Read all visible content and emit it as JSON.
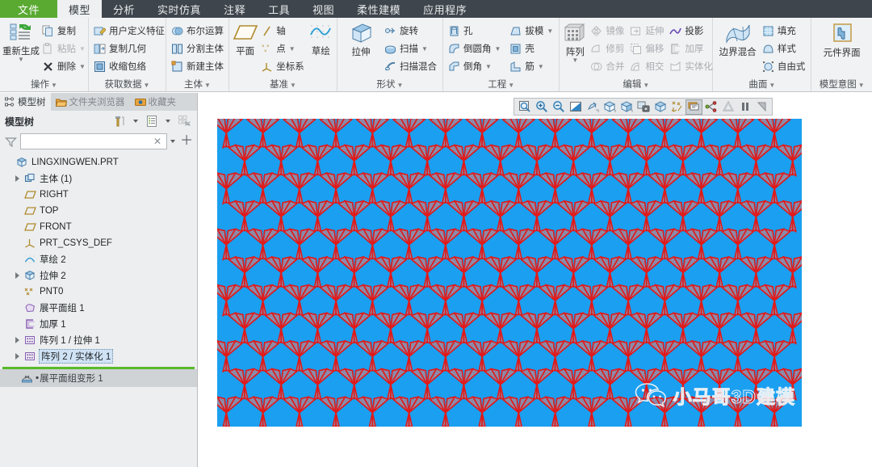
{
  "app": {
    "menu_tabs": [
      {
        "label": "文件",
        "state": "file"
      },
      {
        "label": "模型",
        "state": "active"
      },
      {
        "label": "分析",
        "state": "normal"
      },
      {
        "label": "实时仿真",
        "state": "normal"
      },
      {
        "label": "注释",
        "state": "normal"
      },
      {
        "label": "工具",
        "state": "normal"
      },
      {
        "label": "视图",
        "state": "normal"
      },
      {
        "label": "柔性建模",
        "state": "normal"
      },
      {
        "label": "应用程序",
        "state": "normal"
      }
    ]
  },
  "ribbon": {
    "groups": [
      {
        "title": "操作",
        "has_dropdown": true,
        "big": {
          "label": "重新生成",
          "icon": "regenerate-icon",
          "has_caret": true
        },
        "items": [
          {
            "label": "复制",
            "icon": "copy-icon",
            "caret": false,
            "disabled": false
          },
          {
            "label": "粘贴",
            "icon": "paste-icon",
            "caret": true,
            "disabled": true
          },
          {
            "label": "删除",
            "icon": "delete-icon",
            "caret": true,
            "disabled": false
          }
        ]
      },
      {
        "title": "获取数据",
        "has_dropdown": true,
        "items": [
          {
            "label": "用户定义特征",
            "icon": "udf-icon",
            "caret": false,
            "disabled": false
          },
          {
            "label": "复制几何",
            "icon": "copy-geometry-icon",
            "caret": false,
            "disabled": false
          },
          {
            "label": "收缩包络",
            "icon": "shrinkwrap-icon",
            "caret": false,
            "disabled": false
          }
        ]
      },
      {
        "title": "主体",
        "has_dropdown": true,
        "items": [
          {
            "label": "布尔运算",
            "icon": "boolean-icon",
            "caret": false,
            "disabled": false
          },
          {
            "label": "分割主体",
            "icon": "split-body-icon",
            "caret": false,
            "disabled": false
          },
          {
            "label": "新建主体",
            "icon": "new-body-icon",
            "caret": false,
            "disabled": false
          }
        ]
      },
      {
        "title": "基准",
        "has_dropdown": true,
        "big": {
          "label": "平面",
          "icon": "datum-plane-icon",
          "has_caret": false
        },
        "items": [
          {
            "label": "轴",
            "icon": "datum-axis-icon",
            "caret": false,
            "disabled": false
          },
          {
            "label": "点",
            "icon": "datum-point-icon",
            "caret": true,
            "disabled": false
          },
          {
            "label": "坐标系",
            "icon": "datum-csys-icon",
            "caret": false,
            "disabled": false
          }
        ],
        "big2": {
          "label": "草绘",
          "icon": "sketch-icon",
          "has_caret": false
        }
      },
      {
        "title": "形状",
        "has_dropdown": true,
        "big": {
          "label": "拉伸",
          "icon": "extrude-icon",
          "has_caret": false
        },
        "items": [
          {
            "label": "旋转",
            "icon": "revolve-icon",
            "caret": false,
            "disabled": false
          },
          {
            "label": "扫描",
            "icon": "sweep-icon",
            "caret": true,
            "disabled": false
          },
          {
            "label": "扫描混合",
            "icon": "swept-blend-icon",
            "caret": false,
            "disabled": false
          }
        ]
      },
      {
        "title": "工程",
        "has_dropdown": true,
        "items": [
          {
            "label": "孔",
            "icon": "hole-icon",
            "caret": false,
            "disabled": false
          },
          {
            "label": "倒圆角",
            "icon": "round-icon",
            "caret": true,
            "disabled": false
          },
          {
            "label": "倒角",
            "icon": "chamfer-icon",
            "caret": true,
            "disabled": false
          }
        ],
        "items2": [
          {
            "label": "拔模",
            "icon": "draft-icon",
            "caret": true,
            "disabled": false
          },
          {
            "label": "壳",
            "icon": "shell-icon",
            "caret": false,
            "disabled": false
          },
          {
            "label": "筋",
            "icon": "rib-icon",
            "caret": true,
            "disabled": false
          }
        ]
      },
      {
        "title": "编辑",
        "has_dropdown": true,
        "big": {
          "label": "阵列",
          "icon": "pattern-icon",
          "has_caret": true
        },
        "items": [
          {
            "label": "镜像",
            "icon": "mirror-icon",
            "caret": false,
            "disabled": true
          },
          {
            "label": "修剪",
            "icon": "trim-icon",
            "caret": false,
            "disabled": true
          },
          {
            "label": "合并",
            "icon": "merge-icon",
            "caret": false,
            "disabled": true
          }
        ],
        "items2": [
          {
            "label": "延伸",
            "icon": "extend-icon",
            "caret": false,
            "disabled": true
          },
          {
            "label": "偏移",
            "icon": "offset-icon",
            "caret": false,
            "disabled": true
          },
          {
            "label": "相交",
            "icon": "intersect-icon",
            "caret": false,
            "disabled": true
          }
        ],
        "items3": [
          {
            "label": "投影",
            "icon": "project-icon",
            "caret": false,
            "disabled": false
          },
          {
            "label": "加厚",
            "icon": "thicken-icon",
            "caret": false,
            "disabled": true
          },
          {
            "label": "实体化",
            "icon": "solidify-icon",
            "caret": false,
            "disabled": true
          }
        ]
      },
      {
        "title": "曲面",
        "has_dropdown": true,
        "big": {
          "label": "边界混合",
          "icon": "boundary-blend-icon",
          "has_caret": false
        },
        "items": [
          {
            "label": "填充",
            "icon": "fill-icon",
            "caret": false,
            "disabled": false
          },
          {
            "label": "样式",
            "icon": "style-icon",
            "caret": false,
            "disabled": false
          },
          {
            "label": "自由式",
            "icon": "freestyle-icon",
            "caret": false,
            "disabled": false
          }
        ]
      },
      {
        "title": "模型意图",
        "has_dropdown": true,
        "big": {
          "label": "元件界面",
          "icon": "component-interface-icon",
          "has_caret": false
        },
        "items": []
      }
    ]
  },
  "left_panel": {
    "tabs": [
      {
        "label": "模型树",
        "icon": "model-tree-icon",
        "active": true
      },
      {
        "label": "文件夹浏览器",
        "icon": "folder-browser-icon",
        "active": false
      },
      {
        "label": "收藏夹",
        "icon": "favorites-icon",
        "active": false
      }
    ],
    "header": {
      "title": "模型树",
      "settings_icon": "tree-filters-icon",
      "display_icon": "tree-display-icon",
      "columns_icon": "tree-columns-icon"
    },
    "filter": {
      "icon": "filter-icon",
      "value": "",
      "placeholder": "",
      "clear_icon": "clear-icon",
      "dropdown_icon": "chevron-down-icon",
      "add_icon": "add-icon"
    },
    "tree": [
      {
        "label": "LINGXINGWEN.PRT",
        "icon": "part-icon",
        "indent": 0,
        "expandable": false,
        "selected": false
      },
      {
        "label": "主体 (1)",
        "icon": "bodies-icon",
        "indent": 1,
        "expandable": true,
        "selected": false
      },
      {
        "label": "RIGHT",
        "icon": "datum-plane-icon",
        "indent": 1,
        "expandable": false,
        "selected": false
      },
      {
        "label": "TOP",
        "icon": "datum-plane-icon",
        "indent": 1,
        "expandable": false,
        "selected": false
      },
      {
        "label": "FRONT",
        "icon": "datum-plane-icon",
        "indent": 1,
        "expandable": false,
        "selected": false
      },
      {
        "label": "PRT_CSYS_DEF",
        "icon": "datum-csys-icon",
        "indent": 1,
        "expandable": false,
        "selected": false
      },
      {
        "label": "草绘 2",
        "icon": "sketch-icon",
        "indent": 1,
        "expandable": false,
        "selected": false
      },
      {
        "label": "拉伸 2",
        "icon": "extrude-icon",
        "indent": 1,
        "expandable": true,
        "selected": false
      },
      {
        "label": "PNT0",
        "icon": "datum-point-icon",
        "indent": 1,
        "expandable": false,
        "selected": false
      },
      {
        "label": "展平面组 1",
        "icon": "flatten-quilt-icon",
        "indent": 1,
        "expandable": false,
        "selected": false
      },
      {
        "label": "加厚 1",
        "icon": "thicken-icon",
        "indent": 1,
        "expandable": false,
        "selected": false
      },
      {
        "label": "阵列 1 / 拉伸 1",
        "icon": "pattern-icon",
        "indent": 1,
        "expandable": true,
        "selected": false
      },
      {
        "label": "阵列 2 / 实体化 1",
        "icon": "pattern-icon",
        "indent": 1,
        "expandable": true,
        "selected": true
      }
    ],
    "inserted_row": {
      "label": "展平面组变形 1",
      "icon": "flatten-deform-icon",
      "prefix": "▪"
    }
  },
  "graphics_toolbar": {
    "buttons": [
      {
        "name": "refit-icon",
        "pressed": false
      },
      {
        "name": "zoom-in-icon",
        "pressed": false
      },
      {
        "name": "zoom-out-icon",
        "pressed": false
      },
      {
        "name": "repaint-icon",
        "pressed": false
      },
      {
        "name": "spin-center-icon",
        "pressed": false
      },
      {
        "name": "saved-orientations-icon",
        "pressed": false
      },
      {
        "name": "view-manager-icon",
        "pressed": false
      },
      {
        "name": "scene-capture-icon",
        "pressed": false
      },
      {
        "name": "display-style-icon",
        "pressed": false
      },
      {
        "name": "datum-display-filters-icon",
        "pressed": false
      },
      {
        "name": "annotation-display-icon",
        "pressed": true
      },
      {
        "name": "spin-pan-icon",
        "pressed": false
      },
      {
        "name": "appearance-gallery-icon",
        "pressed": false
      },
      {
        "name": "pause-icon",
        "pressed": false
      },
      {
        "name": "resume-icon",
        "pressed": false
      }
    ]
  },
  "viewport": {
    "background_color": "#1b9ff0",
    "model_edge_color": "#e01b1b",
    "model_face_color": "#8c8aa8",
    "pattern": {
      "shape": "tripod-star",
      "columns": 16,
      "rows": 11,
      "description": "三叉星形阵列 (阵列 2 / 实体化 1)"
    }
  },
  "watermark": {
    "icon": "wechat-icon",
    "text": "小马哥3D建模",
    "color": "#f4f6f8"
  }
}
